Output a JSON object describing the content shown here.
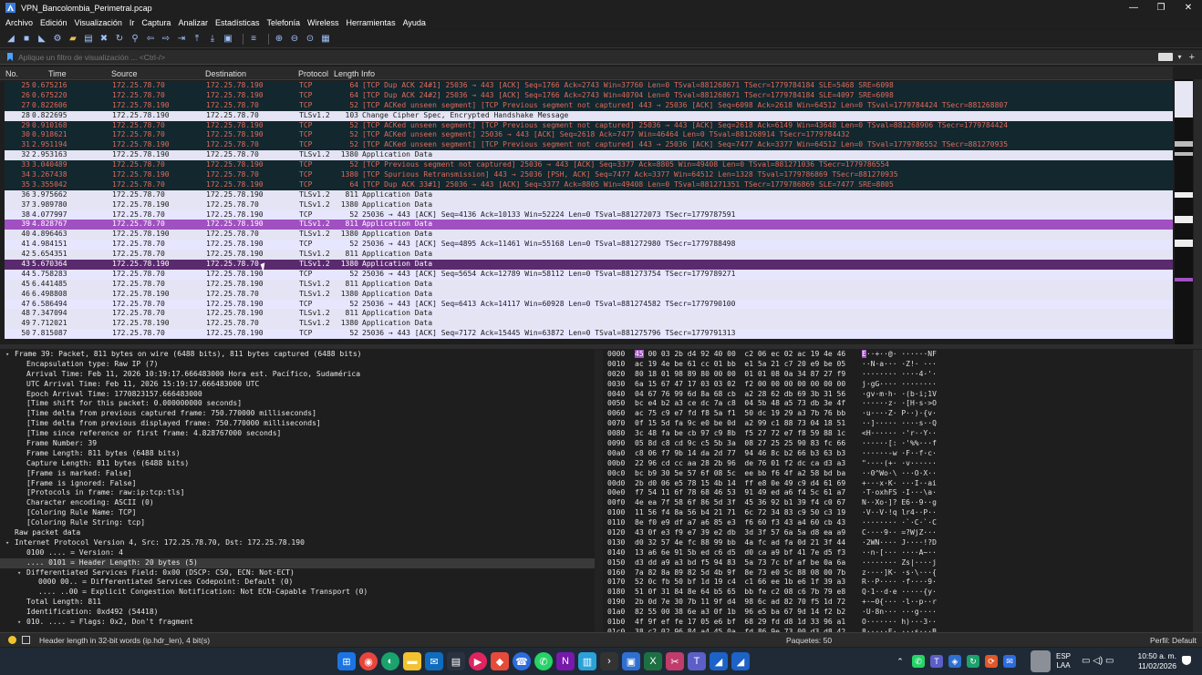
{
  "window": {
    "title": "VPN_Bancolombia_Perimetral.pcap",
    "controls": [
      "—",
      "❐",
      "✕"
    ]
  },
  "menu": [
    "Archivo",
    "Edición",
    "Visualización",
    "Ir",
    "Captura",
    "Analizar",
    "Estadísticas",
    "Telefonía",
    "Wireless",
    "Herramientas",
    "Ayuda"
  ],
  "filter": {
    "placeholder": "Aplique un filtro de visualización ... <Ctrl-/>"
  },
  "columns": {
    "no": "No.",
    "time": "Time",
    "source": "Source",
    "destination": "Destination",
    "protocol": "Protocol",
    "length": "Length",
    "info": "Info"
  },
  "packets": [
    {
      "no": "25",
      "time": "0.675216",
      "src": "172.25.78.70",
      "dst": "172.25.78.190",
      "proto": "TCP",
      "len": "64",
      "info": "[TCP Dup ACK 24#1] 25036 → 443 [ACK] Seq=1766 Ack=2743 Win=37760 Len=0 TSval=881268671 TSecr=1779784184 SLE=5468 SRE=6098",
      "style": "bad"
    },
    {
      "no": "26",
      "time": "0.675220",
      "src": "172.25.78.70",
      "dst": "172.25.78.190",
      "proto": "TCP",
      "len": "64",
      "info": "[TCP Dup ACK 24#2] 25036 → 443 [ACK] Seq=1766 Ack=2743 Win=40704 Len=0 TSval=881268671 TSecr=1779784184 SLE=4097 SRE=6098",
      "style": "bad"
    },
    {
      "no": "27",
      "time": "0.822606",
      "src": "172.25.78.190",
      "dst": "172.25.78.70",
      "proto": "TCP",
      "len": "52",
      "info": "[TCP ACKed unseen segment] [TCP Previous segment not captured] 443 → 25036 [ACK] Seq=6098 Ack=2618 Win=64512 Len=0 TSval=1779784424 TSecr=881268807",
      "style": "bad"
    },
    {
      "no": "28",
      "time": "0.822695",
      "src": "172.25.78.190",
      "dst": "172.25.78.70",
      "proto": "TLSv1.2",
      "len": "103",
      "info": "Change Cipher Spec, Encrypted Handshake Message",
      "style": "tls"
    },
    {
      "no": "29",
      "time": "0.910168",
      "src": "172.25.78.70",
      "dst": "172.25.78.190",
      "proto": "TCP",
      "len": "52",
      "info": "[TCP ACKed unseen segment] [TCP Previous segment not captured] 25036 → 443 [ACK] Seq=2618 Ack=6149 Win=43648 Len=0 TSval=881268906 TSecr=1779784424",
      "style": "bad"
    },
    {
      "no": "30",
      "time": "0.918621",
      "src": "172.25.78.70",
      "dst": "172.25.78.190",
      "proto": "TCP",
      "len": "52",
      "info": "[TCP ACKed unseen segment] 25036 → 443 [ACK] Seq=2618 Ack=7477 Win=46464 Len=0 TSval=881268914 TSecr=1779784432",
      "style": "bad"
    },
    {
      "no": "31",
      "time": "2.951194",
      "src": "172.25.78.190",
      "dst": "172.25.78.70",
      "proto": "TCP",
      "len": "52",
      "info": "[TCP ACKed unseen segment] [TCP Previous segment not captured] 443 → 25036 [ACK] Seq=7477 Ack=3377 Win=64512 Len=0 TSval=1779786552 TSecr=881270935",
      "style": "bad"
    },
    {
      "no": "32",
      "time": "2.953163",
      "src": "172.25.78.190",
      "dst": "172.25.78.70",
      "proto": "TLSv1.2",
      "len": "1380",
      "info": "Application Data",
      "style": "tls"
    },
    {
      "no": "33",
      "time": "3.040489",
      "src": "172.25.78.70",
      "dst": "172.25.78.190",
      "proto": "TCP",
      "len": "52",
      "info": "[TCP Previous segment not captured] 25036 → 443 [ACK] Seq=3377 Ack=8805 Win=49408 Len=0 TSval=881271036 TSecr=1779786554",
      "style": "bad"
    },
    {
      "no": "34",
      "time": "3.267438",
      "src": "172.25.78.190",
      "dst": "172.25.78.70",
      "proto": "TCP",
      "len": "1380",
      "info": "[TCP Spurious Retransmission] 443 → 25036 [PSH, ACK] Seq=7477 Ack=3377 Win=64512 Len=1328 TSval=1779786869 TSecr=881270935",
      "style": "bad"
    },
    {
      "no": "35",
      "time": "3.355042",
      "src": "172.25.78.70",
      "dst": "172.25.78.190",
      "proto": "TCP",
      "len": "64",
      "info": "[TCP Dup ACK 33#1] 25036 → 443 [ACK] Seq=3377 Ack=8805 Win=49408 Len=0 TSval=881271351 TSecr=1779786869 SLE=7477 SRE=8805",
      "style": "bad"
    },
    {
      "no": "36",
      "time": "3.975662",
      "src": "172.25.78.70",
      "dst": "172.25.78.190",
      "proto": "TLSv1.2",
      "len": "811",
      "info": "Application Data",
      "style": "tls"
    },
    {
      "no": "37",
      "time": "3.989780",
      "src": "172.25.78.190",
      "dst": "172.25.78.70",
      "proto": "TLSv1.2",
      "len": "1380",
      "info": "Application Data",
      "style": "tls"
    },
    {
      "no": "38",
      "time": "4.077997",
      "src": "172.25.78.70",
      "dst": "172.25.78.190",
      "proto": "TCP",
      "len": "52",
      "info": "25036 → 443 [ACK] Seq=4136 Ack=10133 Win=52224 Len=0 TSval=881272073 TSecr=1779787591",
      "style": "tcp"
    },
    {
      "no": "39",
      "time": "4.828767",
      "src": "172.25.78.70",
      "dst": "172.25.78.190",
      "proto": "TLSv1.2",
      "len": "811",
      "info": "Application Data",
      "style": "sel39"
    },
    {
      "no": "40",
      "time": "4.896463",
      "src": "172.25.78.190",
      "dst": "172.25.78.70",
      "proto": "TLSv1.2",
      "len": "1380",
      "info": "Application Data",
      "style": "tls"
    },
    {
      "no": "41",
      "time": "4.984151",
      "src": "172.25.78.70",
      "dst": "172.25.78.190",
      "proto": "TCP",
      "len": "52",
      "info": "25036 → 443 [ACK] Seq=4895 Ack=11461 Win=55168 Len=0 TSval=881272980 TSecr=1779788498",
      "style": "tcp"
    },
    {
      "no": "42",
      "time": "5.654351",
      "src": "172.25.78.70",
      "dst": "172.25.78.190",
      "proto": "TLSv1.2",
      "len": "811",
      "info": "Application Data",
      "style": "tls"
    },
    {
      "no": "43",
      "time": "5.670364",
      "src": "172.25.78.190",
      "dst": "172.25.78.70",
      "proto": "TLSv1.2",
      "len": "1380",
      "info": "Application Data",
      "style": "sel43"
    },
    {
      "no": "44",
      "time": "5.758283",
      "src": "172.25.78.70",
      "dst": "172.25.78.190",
      "proto": "TCP",
      "len": "52",
      "info": "25036 → 443 [ACK] Seq=5654 Ack=12789 Win=58112 Len=0 TSval=881273754 TSecr=1779789271",
      "style": "tcp"
    },
    {
      "no": "45",
      "time": "6.441485",
      "src": "172.25.78.70",
      "dst": "172.25.78.190",
      "proto": "TLSv1.2",
      "len": "811",
      "info": "Application Data",
      "style": "tls"
    },
    {
      "no": "46",
      "time": "6.498808",
      "src": "172.25.78.190",
      "dst": "172.25.78.70",
      "proto": "TLSv1.2",
      "len": "1380",
      "info": "Application Data",
      "style": "tls"
    },
    {
      "no": "47",
      "time": "6.586494",
      "src": "172.25.78.70",
      "dst": "172.25.78.190",
      "proto": "TCP",
      "len": "52",
      "info": "25036 → 443 [ACK] Seq=6413 Ack=14117 Win=60928 Len=0 TSval=881274582 TSecr=1779790100",
      "style": "tcp"
    },
    {
      "no": "48",
      "time": "7.347094",
      "src": "172.25.78.70",
      "dst": "172.25.78.190",
      "proto": "TLSv1.2",
      "len": "811",
      "info": "Application Data",
      "style": "tls"
    },
    {
      "no": "49",
      "time": "7.712021",
      "src": "172.25.78.190",
      "dst": "172.25.78.70",
      "proto": "TLSv1.2",
      "len": "1380",
      "info": "Application Data",
      "style": "tls"
    },
    {
      "no": "50",
      "time": "7.815087",
      "src": "172.25.78.70",
      "dst": "172.25.78.190",
      "proto": "TCP",
      "len": "52",
      "info": "25036 → 443 [ACK] Seq=7172 Ack=15445 Win=63872 Len=0 TSval=881275796 TSecr=1779791313",
      "style": "tcp"
    }
  ],
  "details": [
    {
      "arrow": "▾",
      "indent": 0,
      "text": "Frame 39: Packet, 811 bytes on wire (6488 bits), 811 bytes captured (6488 bits)"
    },
    {
      "arrow": "",
      "indent": 1,
      "text": "Encapsulation type: Raw IP (7)"
    },
    {
      "arrow": "",
      "indent": 1,
      "text": "Arrival Time: Feb 11, 2026 10:19:17.666483000 Hora est. Pacífico, Sudamérica"
    },
    {
      "arrow": "",
      "indent": 1,
      "text": "UTC Arrival Time: Feb 11, 2026 15:19:17.666483000 UTC"
    },
    {
      "arrow": "",
      "indent": 1,
      "text": "Epoch Arrival Time: 1770823157.666483000"
    },
    {
      "arrow": "",
      "indent": 1,
      "text": "[Time shift for this packet: 0.000000000 seconds]"
    },
    {
      "arrow": "",
      "indent": 1,
      "text": "[Time delta from previous captured frame: 750.770000 milliseconds]"
    },
    {
      "arrow": "",
      "indent": 1,
      "text": "[Time delta from previous displayed frame: 750.770000 milliseconds]"
    },
    {
      "arrow": "",
      "indent": 1,
      "text": "[Time since reference or first frame: 4.828767000 seconds]"
    },
    {
      "arrow": "",
      "indent": 1,
      "text": "Frame Number: 39"
    },
    {
      "arrow": "",
      "indent": 1,
      "text": "Frame Length: 811 bytes (6488 bits)"
    },
    {
      "arrow": "",
      "indent": 1,
      "text": "Capture Length: 811 bytes (6488 bits)"
    },
    {
      "arrow": "",
      "indent": 1,
      "text": "[Frame is marked: False]"
    },
    {
      "arrow": "",
      "indent": 1,
      "text": "[Frame is ignored: False]"
    },
    {
      "arrow": "",
      "indent": 1,
      "text": "[Protocols in frame: raw:ip:tcp:tls]"
    },
    {
      "arrow": "",
      "indent": 1,
      "text": "Character encoding: ASCII (0)"
    },
    {
      "arrow": "",
      "indent": 1,
      "text": "[Coloring Rule Name: TCP]"
    },
    {
      "arrow": "",
      "indent": 1,
      "text": "[Coloring Rule String: tcp]"
    },
    {
      "arrow": "",
      "indent": 0,
      "text": "Raw packet data"
    },
    {
      "arrow": "▾",
      "indent": 0,
      "text": "Internet Protocol Version 4, Src: 172.25.78.70, Dst: 172.25.78.190"
    },
    {
      "arrow": "",
      "indent": 1,
      "text": "0100 .... = Version: 4"
    },
    {
      "arrow": "",
      "indent": 1,
      "text": ".... 0101 = Header Length: 20 bytes (5)",
      "hl": true
    },
    {
      "arrow": "▾",
      "indent": 1,
      "text": "Differentiated Services Field: 0x00 (DSCP: CS0, ECN: Not-ECT)"
    },
    {
      "arrow": "",
      "indent": 2,
      "text": "0000 00.. = Differentiated Services Codepoint: Default (0)"
    },
    {
      "arrow": "",
      "indent": 2,
      "text": ".... ..00 = Explicit Congestion Notification: Not ECN-Capable Transport (0)"
    },
    {
      "arrow": "",
      "indent": 1,
      "text": "Total Length: 811"
    },
    {
      "arrow": "",
      "indent": 1,
      "text": "Identification: 0xd492 (54418)"
    },
    {
      "arrow": "▾",
      "indent": 1,
      "text": "010. .... = Flags: 0x2, Don't fragment"
    }
  ],
  "bytes": [
    {
      "off": "0000",
      "hex": "45 00 03 2b d4 92 40 00  c2 06 ec 02 ac 19 4e 46",
      "asc": "E··+··@· ······NF"
    },
    {
      "off": "0010",
      "hex": "ac 19 4e be 61 cc 01 bb  e1 5a 21 c7 20 e9 be 05",
      "asc": "··N·a··· ·Z!· ···"
    },
    {
      "off": "0020",
      "hex": "80 18 01 98 89 80 00 00  01 01 08 0a 34 87 27 f9",
      "asc": "········ ····4·'·"
    },
    {
      "off": "0030",
      "hex": "6a 15 67 47 17 03 03 02  f2 00 00 00 00 00 00 00",
      "asc": "j·gG···· ········"
    },
    {
      "off": "0040",
      "hex": "04 67 76 99 6d 8a 68 cb  a2 28 62 db 69 3b 31 56",
      "asc": "·gv·m·h· ·(b·i;1V"
    },
    {
      "off": "0050",
      "hex": "bc e4 b2 a3 ce dc 7a c8  04 5b 48 a5 73 db 3e 4f",
      "asc": "······z· ·[H·s·>O"
    },
    {
      "off": "0060",
      "hex": "ac 75 c9 e7 fd f8 5a f1  50 dc 19 29 a3 7b 76 bb",
      "asc": "·u····Z· P··)·{v·"
    },
    {
      "off": "0070",
      "hex": "0f 15 5d fa 9c e0 be 0d  a2 99 c1 88 73 04 18 51",
      "asc": "··]····· ····s··Q"
    },
    {
      "off": "0080",
      "hex": "3c 48 fa be cb 97 c9 8b  f5 27 72 e7 f8 59 88 1c",
      "asc": "<H······ ·'r··Y··"
    },
    {
      "off": "0090",
      "hex": "05 8d c8 cd 9c c5 5b 3a  08 27 25 25 90 83 fc 66",
      "asc": "······[: ·'%%···f"
    },
    {
      "off": "00a0",
      "hex": "c8 06 f7 9b 14 da 2d 77  94 46 8c b2 66 b3 63 b3",
      "asc": "······-w ·F··f·c·"
    },
    {
      "off": "00b0",
      "hex": "22 96 cd cc aa 28 2b 96  de 76 01 f2 dc ca d3 a3",
      "asc": "\"····(+· ·v······"
    },
    {
      "off": "00c0",
      "hex": "bc b9 30 5e 57 6f 08 5c  ee bb f6 4f a2 58 bd ba",
      "asc": "··0^Wo·\\ ···O·X··"
    },
    {
      "off": "00d0",
      "hex": "2b d0 06 e5 78 15 4b 14  ff e8 0e 49 c9 d4 61 69",
      "asc": "+···x·K· ···I··ai"
    },
    {
      "off": "00e0",
      "hex": "f7 54 11 6f 78 68 46 53  91 49 ed a6 f4 5c 61 a7",
      "asc": "·T·oxhFS ·I···\\a·"
    },
    {
      "off": "00f0",
      "hex": "4e ea 7f 58 6f 86 5d 3f  45 36 92 b1 39 f4 c0 67",
      "asc": "N··Xo·]? E6··9··g"
    },
    {
      "off": "0100",
      "hex": "11 56 f4 8a 56 b4 21 71  6c 72 34 83 c9 50 c3 19",
      "asc": "·V··V·!q lr4··P··"
    },
    {
      "off": "0110",
      "hex": "8e f0 e9 df a7 a6 85 e3  f6 60 f3 43 a4 60 cb 43",
      "asc": "········ ·`·C·`·C"
    },
    {
      "off": "0120",
      "hex": "43 0f e3 f9 e7 39 e2 db  3d 3f 57 6a 5a d8 ea a9",
      "asc": "C····9·· =?WjZ···"
    },
    {
      "off": "0130",
      "hex": "d0 32 57 4e fc 88 99 bb  4a fc ad fa 0d 21 3f 44",
      "asc": "·2WN···· J····!?D"
    },
    {
      "off": "0140",
      "hex": "13 a6 6e 91 5b ed c6 d5  d0 ca a9 bf 41 7e d5 f3",
      "asc": "··n·[··· ····A~··"
    },
    {
      "off": "0150",
      "hex": "d3 dd a9 a3 bd f5 94 83  5a 73 7c bf af be 0a 6a",
      "asc": "········ Zs|····j"
    },
    {
      "off": "0160",
      "hex": "7a 82 8a 89 82 5d 4b 9f  8e 73 e0 5c 88 08 00 7b",
      "asc": "z····]K· ·s·\\···{"
    },
    {
      "off": "0170",
      "hex": "52 0c fb 50 bf 1d 19 c4  c1 66 ee 1b e6 1f 39 a3",
      "asc": "R··P···· ·f····9·"
    },
    {
      "off": "0180",
      "hex": "51 0f 31 84 8e 64 b5 65  bb fe c2 08 c6 7b 79 e8",
      "asc": "Q·1··d·e ·····{y·"
    },
    {
      "off": "0190",
      "hex": "2b 0d 7e 30 7b 11 9f d4  98 6c ad 82 70 f5 1d 72",
      "asc": "+·~0{··· ·l··p··r"
    },
    {
      "off": "01a0",
      "hex": "82 55 00 38 6e a3 0f 1b  96 e5 ba 67 9d 14 f2 b2",
      "asc": "·U·8n··· ···g····"
    },
    {
      "off": "01b0",
      "hex": "4f 9f ef fe 17 05 e6 bf  68 29 fd d8 1d 33 96 a1",
      "asc": "O······· h)···3··"
    },
    {
      "off": "01c0",
      "hex": "38 c2 02 96 84 a4 45 0a  fd 86 9e 73 00 d3 d8 42",
      "asc": "8·····E· ···s···B"
    },
    {
      "off": "01d0",
      "hex": "3d dc ac 09 b1 10 c9 23  23 56 0e 03 73 7f fa 43",
      "asc": "=······# #V··s··C"
    }
  ],
  "status": {
    "field_text": "Header length in 32-bit words (ip.hdr_len), 4 bit(s)",
    "packets": "Paquetes: 50",
    "profile": "Perfil: Default"
  },
  "taskbar": {
    "lang_top": "ESP",
    "lang_bottom": "LAA",
    "time": "10:50 a. m.",
    "date": "11/02/2026"
  }
}
